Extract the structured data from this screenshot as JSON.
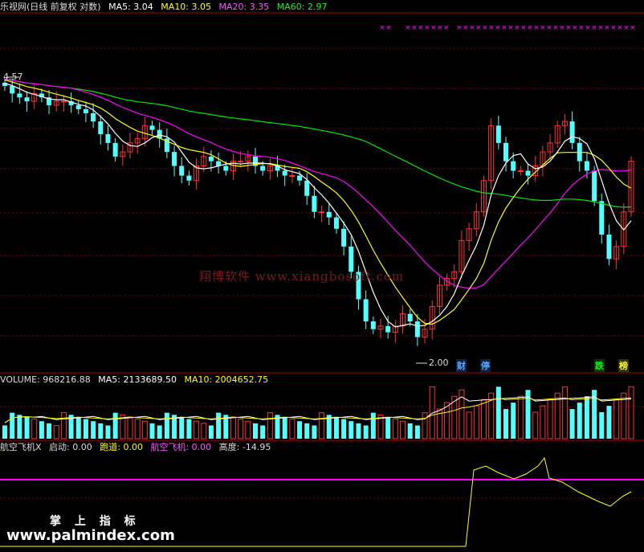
{
  "main_panel": {
    "title": "乐视网(日线 前复权 对数)",
    "ma5_label": "MA5: 3.04",
    "ma10_label": "MA10: 3.05",
    "ma20_label": "MA20: 3.35",
    "ma60_label": "MA60: 2.97",
    "high_marker": "4.57",
    "low_marker": "2.00",
    "event_labels": [
      "财",
      "停",
      "跌",
      "榜"
    ],
    "watermark": "翔博软件 www.xiangbosoft.com"
  },
  "volume_panel": {
    "volume_label": "VOLUME: 968216.88",
    "ma5_label": "MA5: 2133689.50",
    "ma10_label": "MA10: 2004652.75"
  },
  "indicator_panel": {
    "name": "航空飞机X",
    "start_label": "启动: 0.00",
    "runway_label": "跑道: 0.00",
    "plane_label": "航空飞机: 0.00",
    "height_label": "高度: -14.95"
  },
  "brand": {
    "line1": "掌 上 指 标",
    "line2": "www.palmindex.com"
  },
  "colors": {
    "up": "#ff3232",
    "down": "#54ffff",
    "ma5": "#ffffff",
    "ma10": "#ffff00",
    "ma20": "#ff00ff",
    "ma60": "#00e600",
    "grid": "#800000"
  },
  "chart_data": {
    "type": "candlestick",
    "scale": "log",
    "series_close": [
      4.4,
      4.3,
      4.25,
      4.2,
      4.3,
      4.25,
      4.15,
      4.2,
      4.2,
      4.15,
      4.1,
      4.05,
      3.95,
      3.8,
      3.7,
      3.55,
      3.6,
      3.7,
      3.75,
      3.9,
      3.85,
      3.75,
      3.6,
      3.45,
      3.35,
      3.3,
      3.45,
      3.55,
      3.5,
      3.45,
      3.4,
      3.5,
      3.5,
      3.55,
      3.45,
      3.4,
      3.45,
      3.4,
      3.35,
      3.35,
      3.3,
      3.15,
      3.0,
      3.0,
      2.95,
      2.85,
      2.7,
      2.5,
      2.3,
      2.15,
      2.1,
      2.12,
      2.08,
      2.12,
      2.2,
      2.15,
      2.05,
      2.1,
      2.25,
      2.4,
      2.45,
      2.5,
      2.75,
      2.85,
      3.0,
      3.3,
      3.9,
      3.7,
      3.5,
      3.4,
      3.4,
      3.35,
      3.45,
      3.6,
      3.7,
      3.9,
      3.95,
      3.7,
      3.5,
      3.4,
      3.1,
      2.8,
      2.6,
      2.7,
      3.0,
      3.5
    ],
    "ma60_labels": {
      "MA5": 3.04,
      "MA10": 3.05,
      "MA20": 3.35,
      "MA60": 2.97
    },
    "volume": {
      "last": 968216.88,
      "ma5": 2133689.5,
      "ma10": 2004652.75
    },
    "indicator": {
      "start": 0.0,
      "runway": 0.0,
      "plane": 0.0,
      "height": -14.95
    }
  }
}
